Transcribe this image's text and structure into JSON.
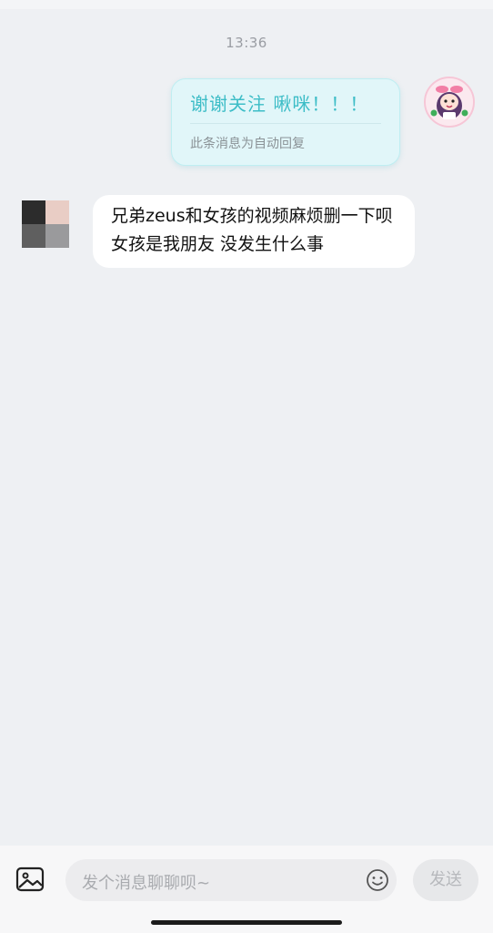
{
  "chat": {
    "timestamp": "13:36",
    "auto_reply": {
      "text": "谢谢关注  啾咪！！！",
      "note": "此条消息为自动回复"
    },
    "incoming": {
      "text": "兄弟zeus和女孩的视频麻烦删一下呗 女孩是我朋友 没发生什么事"
    }
  },
  "composer": {
    "placeholder": "发个消息聊聊呗~",
    "send_label": "发送"
  },
  "icons": {
    "image": "image-icon",
    "emoji": "emoji-icon"
  },
  "colors": {
    "background": "#eef0f3",
    "auto_reply_bubble": "#e1f6f9",
    "auto_reply_text": "#3dbdc7",
    "incoming_bubble": "#ffffff"
  }
}
